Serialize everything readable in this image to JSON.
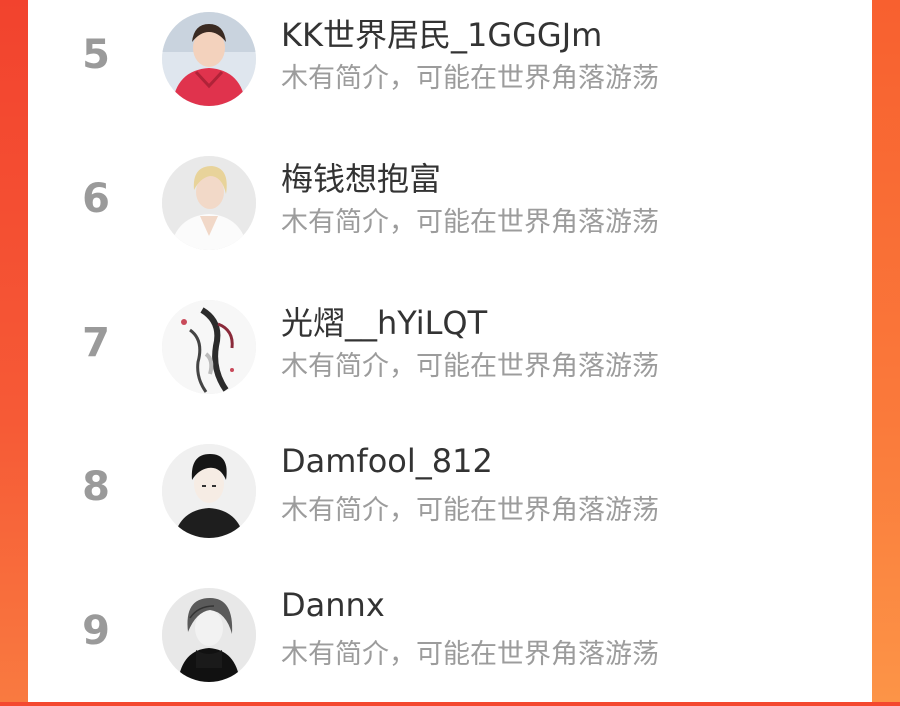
{
  "ranking_list": {
    "items": [
      {
        "rank": "5",
        "name": "KK世界居民_1GGGJm",
        "bio": "木有简介，可能在世界角落游荡",
        "avatar_icon": "person-red-jacket-avatar"
      },
      {
        "rank": "6",
        "name": "梅钱想抱富",
        "bio": "木有简介，可能在世界角落游荡",
        "avatar_icon": "blonde-person-white-shirt-avatar"
      },
      {
        "rank": "7",
        "name": "光熠__hYiLQT",
        "bio": "木有简介，可能在世界角落游荡",
        "avatar_icon": "ink-illustration-figure-avatar"
      },
      {
        "rank": "8",
        "name": "Damfool_812",
        "bio": "木有简介，可能在世界角落游荡",
        "avatar_icon": "sketch-man-portrait-avatar"
      },
      {
        "rank": "9",
        "name": "Dannx",
        "bio": "木有简介，可能在世界角落游荡",
        "avatar_icon": "sketch-long-hair-portrait-avatar"
      }
    ]
  },
  "colors": {
    "background_accent": "#f7653a",
    "rank_text": "#9a9a9a",
    "name_text": "#333333",
    "bio_text": "#9c9c9c"
  }
}
